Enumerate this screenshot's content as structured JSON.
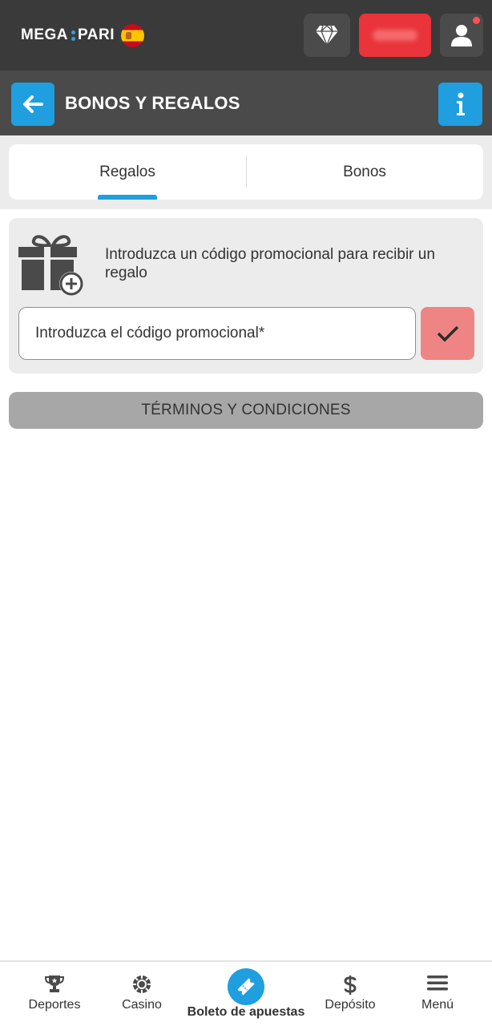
{
  "header": {
    "logo_left": "MEGA",
    "logo_right": "PARI",
    "flag": "spain-flag",
    "icons": {
      "vip": "diamond-icon",
      "user": "user-icon"
    },
    "balance_value": "",
    "notification": "red-dot"
  },
  "titlebar": {
    "title": "BONOS Y REGALOS",
    "back_icon": "arrow-left-icon",
    "info_icon": "info-icon"
  },
  "tabs": [
    {
      "label": "Regalos",
      "active": true
    },
    {
      "label": "Bonos",
      "active": false
    }
  ],
  "promo": {
    "description": "Introduzca un código promocional para recibir un regalo",
    "input_placeholder": "Introduzca el código promocional*",
    "submit_icon": "check-icon"
  },
  "terms_label": "TÉRMINOS Y CONDICIONES",
  "bottom_nav": [
    {
      "label": "Deportes",
      "icon": "trophy-icon"
    },
    {
      "label": "Casino",
      "icon": "casino-chip-icon"
    },
    {
      "label": "Boleto de apuestas",
      "icon": "ticket-icon"
    },
    {
      "label": "Depósito",
      "icon": "dollar-icon"
    },
    {
      "label": "Menú",
      "icon": "hamburger-menu-icon"
    }
  ],
  "colors": {
    "header_bg": "#3a3a3a",
    "titlebar_bg": "#4a4a4a",
    "accent_blue": "#1f9ee0",
    "balance_red": "#e8343a",
    "submit_pink": "#ee8584",
    "terms_gray": "#a7a7a7"
  }
}
